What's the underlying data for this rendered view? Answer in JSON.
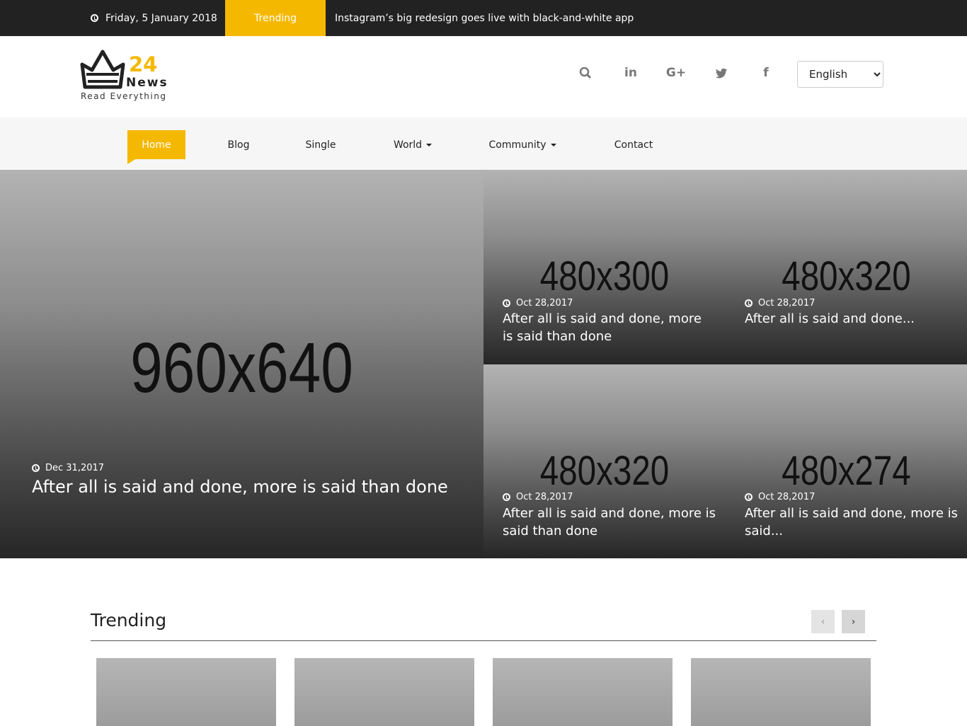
{
  "topbar": {
    "date": "Friday, 5 January 2018",
    "trending_label": "Trending",
    "headline": "Instagram’s big redesign goes live with black-and-white app"
  },
  "logo": {
    "number": "24",
    "word": "News",
    "tagline": "Read Everything"
  },
  "header": {
    "social_icons": [
      "search-icon",
      "linkedin-icon",
      "google-plus-icon",
      "twitter-icon",
      "facebook-icon"
    ],
    "social_glyphs": {
      "linkedin": "in",
      "google_plus": "G+",
      "facebook": "f"
    },
    "language": {
      "selected": "English",
      "options": [
        "English"
      ]
    }
  },
  "nav": {
    "items": [
      {
        "label": "Home",
        "active": true
      },
      {
        "label": "Blog"
      },
      {
        "label": "Single"
      },
      {
        "label": "World",
        "dropdown": true
      },
      {
        "label": "Community",
        "dropdown": true
      },
      {
        "label": "Contact"
      }
    ]
  },
  "hero": {
    "main": {
      "placeholder": "960x640",
      "date": "Dec 31,2017",
      "title": "After all is said and done, more is said than done"
    },
    "tiles": [
      {
        "placeholder": "480x300",
        "date": "Oct 28,2017",
        "title": "After all is said and done, more is said than done"
      },
      {
        "placeholder": "480x320",
        "date": "Oct 28,2017",
        "title": "After all is said and done..."
      },
      {
        "placeholder": "480x320",
        "date": "Oct 28,2017",
        "title": "After all is said and done, more is said than done"
      },
      {
        "placeholder": "480x274",
        "date": "Oct 28,2017",
        "title": "After all is said and done, more is said..."
      }
    ]
  },
  "trending": {
    "heading": "Trending",
    "prev_glyph": "‹",
    "next_glyph": "›"
  },
  "colors": {
    "accent": "#f5b800",
    "topbar": "#222222",
    "nav_bg": "#f6f6f6"
  }
}
